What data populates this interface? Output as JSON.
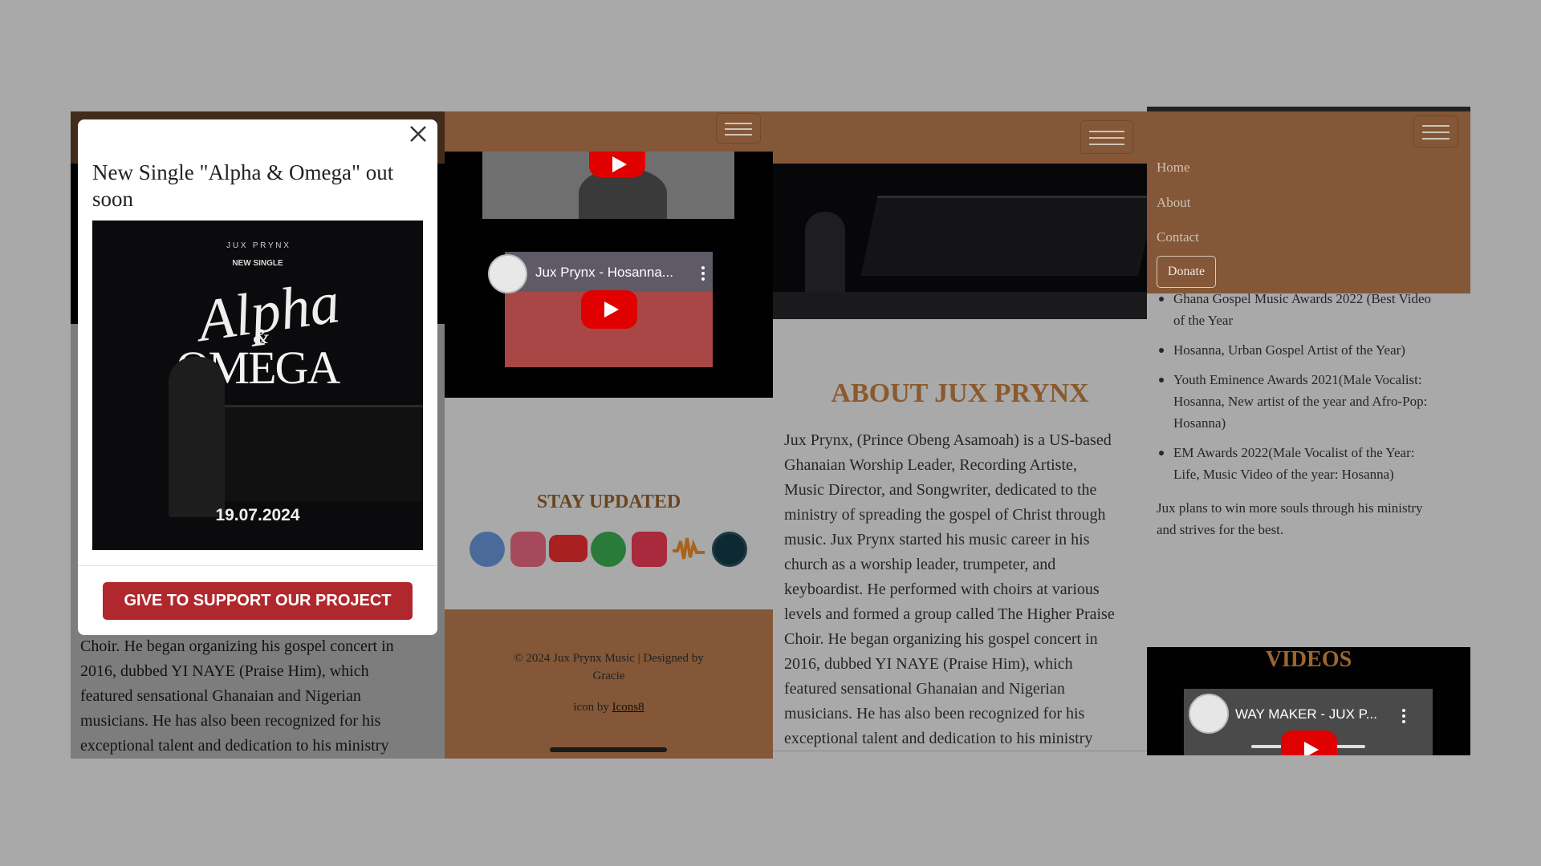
{
  "panel1": {
    "modal": {
      "title": "New Single \"Alpha & Omega\" out soon",
      "close_label": "×",
      "poster": {
        "artist": "J U X   P R Y N X",
        "tag": "NEW SINGLE",
        "title_script": "Alpha",
        "ampersand": "&",
        "title_caps": "OMEGA",
        "date": "19.07.2024"
      },
      "cta_label": "GIVE TO SUPPORT OUR PROJECT"
    },
    "bg_text": [
      "Choir. He began organizing his gospel concert in",
      "2016, dubbed YI NAYE (Praise Him), which",
      "featured sensational Ghanaian and Nigerian",
      "musicians. He has also been recognized for his",
      "exceptional talent and dedication to his ministry"
    ]
  },
  "panel2": {
    "video2_title": "Jux Prynx - Hosanna...",
    "stay_updated": "STAY UPDATED",
    "socials": [
      "facebook-icon",
      "instagram-icon",
      "youtube-icon",
      "spotify-icon",
      "apple-music-icon",
      "audiomack-icon",
      "boomplay-icon"
    ],
    "footer": {
      "copyright_line1": "© 2024 Jux Prynx Music | Designed by",
      "copyright_line2": "Gracie",
      "icon_prefix": "icon by ",
      "icon_link": "Icons8"
    }
  },
  "panel3": {
    "about_title": "ABOUT JUX PRYNX",
    "about_lines": [
      "Jux Prynx, (Prince Obeng Asamoah) is a US-based",
      "Ghanaian Worship Leader, Recording Artiste,",
      "Music Director, and Songwriter, dedicated to the",
      "ministry of spreading the gospel of Christ through",
      "music. Jux Prynx started his music career in his",
      "church as a worship leader, trumpeter, and",
      "keyboardist. He performed with choirs at various",
      "levels and formed a group called The Higher Praise",
      "Choir. He began organizing his gospel concert in",
      "2016, dubbed YI NAYE (Praise Him), which",
      "featured sensational Ghanaian and Nigerian",
      "musicians. He has also been recognized for his",
      "exceptional talent and dedication to his ministry"
    ]
  },
  "panel4": {
    "nav": [
      "Home",
      "About",
      "Contact"
    ],
    "donate_label": "Donate",
    "awards": [
      [
        "Ghana Gospel Music Awards 2022 (Best Video",
        "of the Year"
      ],
      [
        "Hosanna, Urban Gospel Artist of the Year)"
      ],
      [
        "Youth Eminence Awards 2021(Male Vocalist:",
        "Hosanna, New artist of the year and Afro-Pop:",
        "Hosanna)"
      ],
      [
        "EM Awards 2022(Male Vocalist of the Year:",
        "Life, Music Video of the year: Hosanna)"
      ]
    ],
    "plans": [
      "Jux plans to win more souls through his ministry",
      "and strives for the best."
    ],
    "videos_title": "VIDEOS",
    "video_title": "WAY MAKER - JUX P..."
  },
  "colors": {
    "brown": "#835737",
    "title_brown": "#9b6630",
    "cta_red": "#b0282e",
    "page_gray": "#a9a9a9"
  }
}
